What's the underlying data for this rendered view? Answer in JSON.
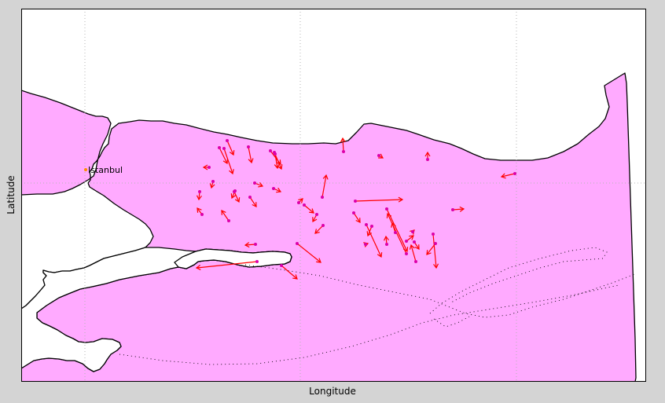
{
  "figure": {
    "background_color": "#d4d4d4",
    "xlabel": "Longitude",
    "ylabel": "Latitude"
  },
  "map": {
    "sea_color": "#ffffff",
    "land_color": "#ffaaff",
    "coastline_color": "#000000",
    "grid": true,
    "grid_color": "#b4b4b4",
    "fault_trace_style": "dotted"
  },
  "city": {
    "name": "Istanbul",
    "marker_color": "#ff8c00"
  },
  "gps_vectors": {
    "arrow_color": "#ff0000",
    "station_color": "#dd00aa",
    "count": 44
  }
}
